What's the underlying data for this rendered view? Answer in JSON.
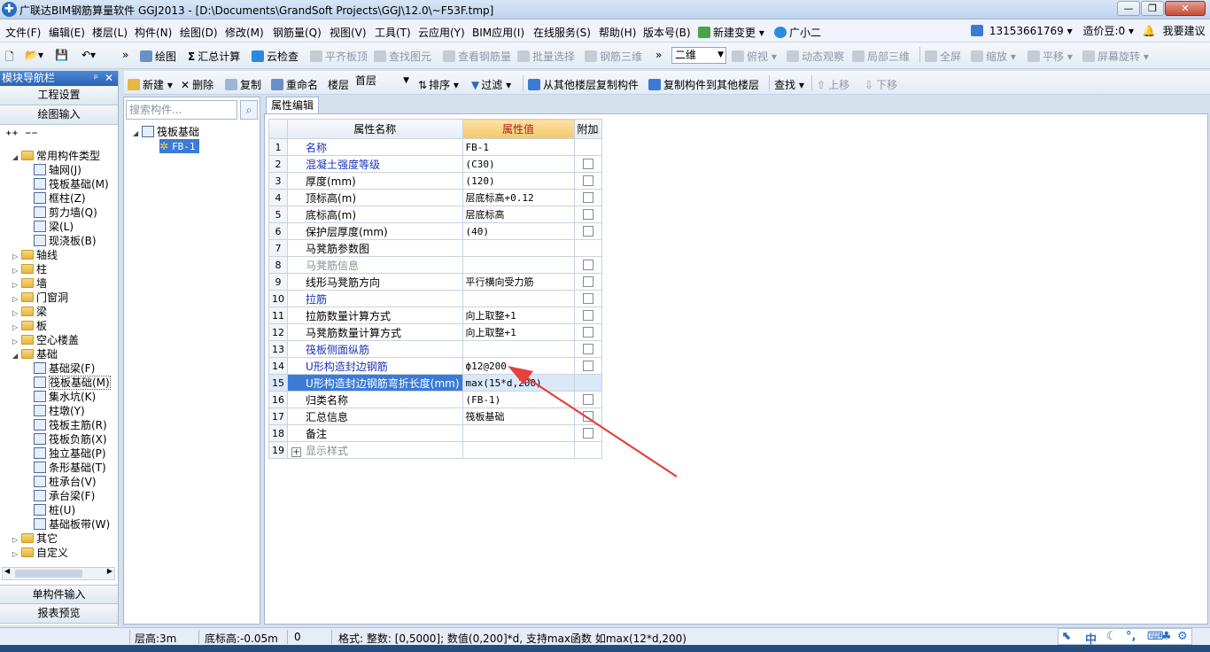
{
  "window": {
    "title": "广联达BIM钢筋算量软件 GGJ2013 - [D:\\Documents\\GrandSoft Projects\\GGJ\\12.0\\~F53F.tmp]",
    "min": "—",
    "max": "❐",
    "close": "✕"
  },
  "menu": {
    "items": [
      "文件(F)",
      "编辑(E)",
      "楼层(L)",
      "构件(N)",
      "绘图(D)",
      "修改(M)",
      "钢筋量(Q)",
      "视图(V)",
      "工具(T)",
      "云应用(Y)",
      "BIM应用(I)",
      "在线服务(S)",
      "帮助(H)",
      "版本号(B)",
      "新建变更 ▾",
      "广小二"
    ],
    "account": "13153661769",
    "cost_beans": "造价豆:0",
    "suggest": "我要建议"
  },
  "toolbar1": {
    "draw": "绘图",
    "sum": "汇总计算",
    "cloud_check": "云检查",
    "align_top": "平齐板顶",
    "find_elem": "查找图元",
    "view_rebar": "查看钢筋量",
    "batch_select": "批量选择",
    "rebar_3d": "钢筋三维",
    "view_mode": "二维",
    "top_view": "俯视",
    "dynamic_view": "动态观察",
    "partial_3d": "局部三维",
    "fullscreen": "全屏",
    "zoom": "缩放",
    "pan": "平移",
    "rotate": "屏幕旋转"
  },
  "toolbar2": {
    "new": "新建",
    "delete": "删除",
    "copy": "复制",
    "rename": "重命名",
    "floor_label": "楼层",
    "floor_value": "首层",
    "sort": "排序",
    "filter": "过滤",
    "copy_from": "从其他楼层复制构件",
    "copy_to": "复制构件到其他楼层",
    "find": "查找",
    "up": "上移",
    "down": "下移"
  },
  "nav": {
    "header": "模块导航栏",
    "pin": "ᵖ",
    "close": "✕",
    "project_settings": "工程设置",
    "drawing_input": "绘图输入",
    "expand_all": "⁺⁺",
    "collapse_all": "⁻⁻",
    "tree": [
      {
        "label": "常用构件类型",
        "level": 0,
        "type": "folder",
        "open": true
      },
      {
        "label": "轴网(J)",
        "level": 1,
        "type": "item"
      },
      {
        "label": "筏板基础(M)",
        "level": 1,
        "type": "item"
      },
      {
        "label": "框柱(Z)",
        "level": 1,
        "type": "item"
      },
      {
        "label": "剪力墙(Q)",
        "level": 1,
        "type": "item"
      },
      {
        "label": "梁(L)",
        "level": 1,
        "type": "item"
      },
      {
        "label": "现浇板(B)",
        "level": 1,
        "type": "item"
      },
      {
        "label": "轴线",
        "level": 0,
        "type": "folder"
      },
      {
        "label": "柱",
        "level": 0,
        "type": "folder"
      },
      {
        "label": "墙",
        "level": 0,
        "type": "folder"
      },
      {
        "label": "门窗洞",
        "level": 0,
        "type": "folder"
      },
      {
        "label": "梁",
        "level": 0,
        "type": "folder"
      },
      {
        "label": "板",
        "level": 0,
        "type": "folder"
      },
      {
        "label": "空心楼盖",
        "level": 0,
        "type": "folder"
      },
      {
        "label": "基础",
        "level": 0,
        "type": "folder",
        "open": true
      },
      {
        "label": "基础梁(F)",
        "level": 1,
        "type": "item"
      },
      {
        "label": "筏板基础(M)",
        "level": 1,
        "type": "item",
        "selected": true
      },
      {
        "label": "集水坑(K)",
        "level": 1,
        "type": "item"
      },
      {
        "label": "柱墩(Y)",
        "level": 1,
        "type": "item"
      },
      {
        "label": "筏板主筋(R)",
        "level": 1,
        "type": "item"
      },
      {
        "label": "筏板负筋(X)",
        "level": 1,
        "type": "item"
      },
      {
        "label": "独立基础(P)",
        "level": 1,
        "type": "item"
      },
      {
        "label": "条形基础(T)",
        "level": 1,
        "type": "item"
      },
      {
        "label": "桩承台(V)",
        "level": 1,
        "type": "item"
      },
      {
        "label": "承台梁(F)",
        "level": 1,
        "type": "item"
      },
      {
        "label": "桩(U)",
        "level": 1,
        "type": "item"
      },
      {
        "label": "基础板带(W)",
        "level": 1,
        "type": "item"
      },
      {
        "label": "其它",
        "level": 0,
        "type": "folder"
      },
      {
        "label": "自定义",
        "level": 0,
        "type": "folder"
      }
    ],
    "single_input": "单构件输入",
    "report_preview": "报表预览"
  },
  "components": {
    "search_placeholder": "搜索构件...",
    "root": "筏板基础",
    "child": "FB-1"
  },
  "property": {
    "tab": "属性编辑",
    "headers": {
      "name": "属性名称",
      "value": "属性值",
      "extra": "附加"
    },
    "rows": [
      {
        "n": "1",
        "name": "名称",
        "value": "FB-1",
        "color": "blue",
        "check": false
      },
      {
        "n": "2",
        "name": "混凝土强度等级",
        "value": "(C30)",
        "color": "blue",
        "check": true
      },
      {
        "n": "3",
        "name": "厚度(mm)",
        "value": "(120)",
        "color": "black",
        "check": true
      },
      {
        "n": "4",
        "name": "顶标高(m)",
        "value": "层底标高+0.12",
        "color": "black",
        "check": true
      },
      {
        "n": "5",
        "name": "底标高(m)",
        "value": "层底标高",
        "color": "black",
        "check": true
      },
      {
        "n": "6",
        "name": "保护层厚度(mm)",
        "value": "(40)",
        "color": "black",
        "check": true
      },
      {
        "n": "7",
        "name": "马凳筋参数图",
        "value": "",
        "color": "black",
        "check": false
      },
      {
        "n": "8",
        "name": "马凳筋信息",
        "value": "",
        "color": "gray",
        "check": true
      },
      {
        "n": "9",
        "name": "线形马凳筋方向",
        "value": "平行横向受力筋",
        "color": "black",
        "check": true
      },
      {
        "n": "10",
        "name": "拉筋",
        "value": "",
        "color": "blue",
        "check": true
      },
      {
        "n": "11",
        "name": "拉筋数量计算方式",
        "value": "向上取整+1",
        "color": "black",
        "check": true
      },
      {
        "n": "12",
        "name": "马凳筋数量计算方式",
        "value": "向上取整+1",
        "color": "black",
        "check": true
      },
      {
        "n": "13",
        "name": "筏板侧面纵筋",
        "value": "",
        "color": "blue",
        "check": true
      },
      {
        "n": "14",
        "name": "U形构造封边钢筋",
        "value": "ф12@200",
        "color": "blue",
        "check": true
      },
      {
        "n": "15",
        "name": "U形构造封边钢筋弯折长度(mm)",
        "value": "max(15*d,200)",
        "color": "blue",
        "check": false,
        "selected": true
      },
      {
        "n": "16",
        "name": "归类名称",
        "value": "(FB-1)",
        "color": "black",
        "check": true
      },
      {
        "n": "17",
        "name": "汇总信息",
        "value": "筏板基础",
        "color": "black",
        "check": true
      },
      {
        "n": "18",
        "name": "备注",
        "value": "",
        "color": "black",
        "check": true
      },
      {
        "n": "19",
        "name": "显示样式",
        "value": "",
        "color": "gray",
        "check": false,
        "expandable": true
      }
    ]
  },
  "status": {
    "floor_height": "层高:3m",
    "floor_bottom": "底标高:-0.05m",
    "value": "0",
    "format_hint": "格式: 整数: [0,5000]; 数值(0,200]*d, 支持max函数 如max(12*d,200)"
  },
  "ime": {
    "zh": "中"
  },
  "colors": {
    "annotation_arrow": "#e8413a",
    "selection": "#3b7bd6",
    "header_value": "#f4c86b"
  }
}
